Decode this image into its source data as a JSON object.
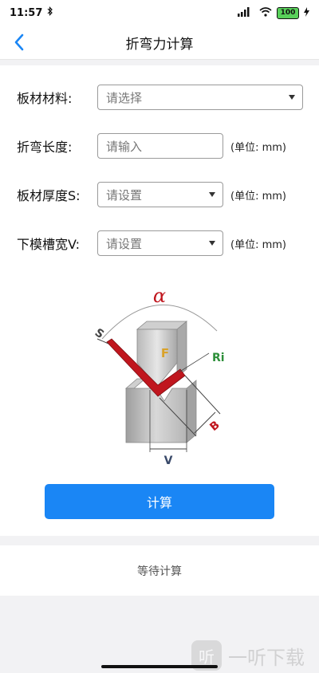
{
  "status_bar": {
    "time": "11:57",
    "battery": "100"
  },
  "nav": {
    "title": "折弯力计算",
    "back_icon": "chevron-left-icon"
  },
  "form": {
    "material": {
      "label": "板材材料:",
      "placeholder": "请选择"
    },
    "bend_length": {
      "label": "折弯长度:",
      "placeholder": "请输入",
      "unit": "(单位: mm)"
    },
    "thickness": {
      "label": "板材厚度S:",
      "placeholder": "请设置",
      "unit": "(单位: mm)"
    },
    "die_width": {
      "label": "下模槽宽V:",
      "placeholder": "请设置",
      "unit": "(单位: mm)"
    }
  },
  "diagram": {
    "alpha": "α",
    "s": "S",
    "f": "F",
    "ri": "Ri",
    "b": "B",
    "v": "V"
  },
  "actions": {
    "calculate": "计算"
  },
  "result": {
    "text": "等待计算"
  },
  "watermark": {
    "text": "一听下载",
    "icon_glyph": "听"
  },
  "colors": {
    "primary": "#1a86f5",
    "sheet": "#c0161e",
    "ri_green": "#2d8f3a",
    "f_gold": "#d9a22a"
  }
}
